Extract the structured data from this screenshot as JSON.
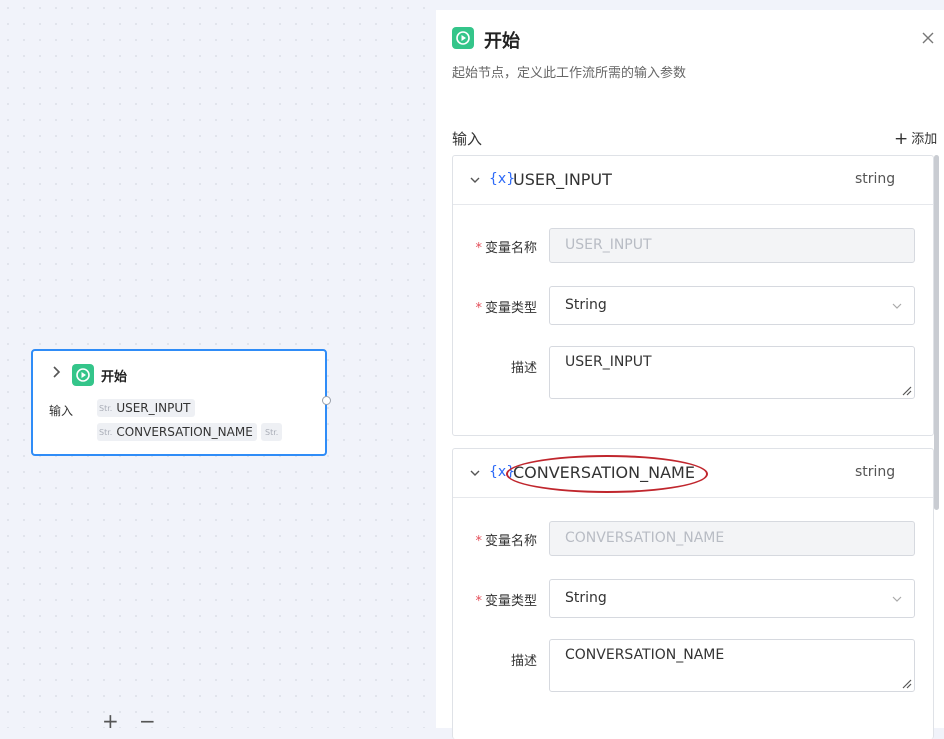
{
  "canvas": {
    "node": {
      "title": "开始",
      "input_label": "输入",
      "tags": [
        {
          "name": "USER_INPUT",
          "type_abbr": "Str."
        },
        {
          "name": "CONVERSATION_NAME",
          "type_abbr": "Str."
        },
        {
          "type_abbr": "Str."
        }
      ]
    },
    "zoom_in_label": "+",
    "zoom_out_label": "−"
  },
  "panel": {
    "title": "开始",
    "description": "起始节点，定义此工作流所需的输入参数",
    "section_label": "输入",
    "add_label": "添加",
    "add_icon": "+",
    "variables": [
      {
        "icon_text": "{x}",
        "name": "USER_INPUT",
        "type": "string",
        "fields": {
          "name_label": "变量名称",
          "name_value": "USER_INPUT",
          "type_label": "变量类型",
          "type_value": "String",
          "desc_label": "描述",
          "desc_value": "USER_INPUT"
        }
      },
      {
        "icon_text": "{x}",
        "name": "CONVERSATION_NAME",
        "type": "string",
        "fields": {
          "name_label": "变量名称",
          "name_value": "CONVERSATION_NAME",
          "type_label": "变量类型",
          "type_value": "String",
          "desc_label": "描述",
          "desc_value": "CONVERSATION_NAME"
        }
      }
    ]
  },
  "colors": {
    "accent": "#2f8cf7",
    "start_icon": "#34c58a",
    "required": "#e34d59",
    "annotation": "#c0262d",
    "var_icon": "#2f6bf7"
  }
}
